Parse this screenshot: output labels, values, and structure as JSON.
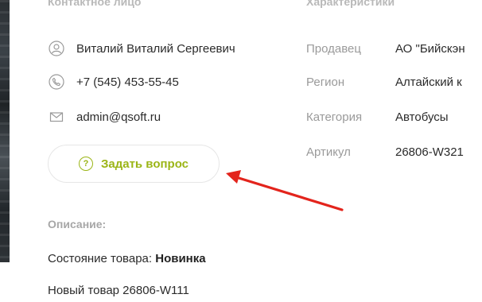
{
  "contact": {
    "heading": "Контактное лицо",
    "name": "Виталий Виталий Сергеевич",
    "phone": "+7 (545) 453-55-45",
    "email": "admin@qsoft.ru",
    "ask_button_icon": "?",
    "ask_button_label": "Задать вопрос"
  },
  "characteristics": {
    "heading": "Характеристики",
    "rows": [
      {
        "key": "Продавец",
        "value": "АО \"Бийскэн"
      },
      {
        "key": "Регион",
        "value": "Алтайский к"
      },
      {
        "key": "Категория",
        "value": "Автобусы"
      },
      {
        "key": "Артикул",
        "value": "26806-W321"
      }
    ]
  },
  "description": {
    "title": "Описание:",
    "condition_label": "Состояние товара:",
    "condition_value": "Новинка",
    "text": "Новый товар 26806-W111"
  },
  "icons": {
    "name": "user-icon",
    "phone": "phone-icon",
    "email": "mail-icon",
    "question": "question-circle-icon"
  },
  "colors": {
    "accent": "#9bb516",
    "annotation_arrow": "#e3241c"
  }
}
